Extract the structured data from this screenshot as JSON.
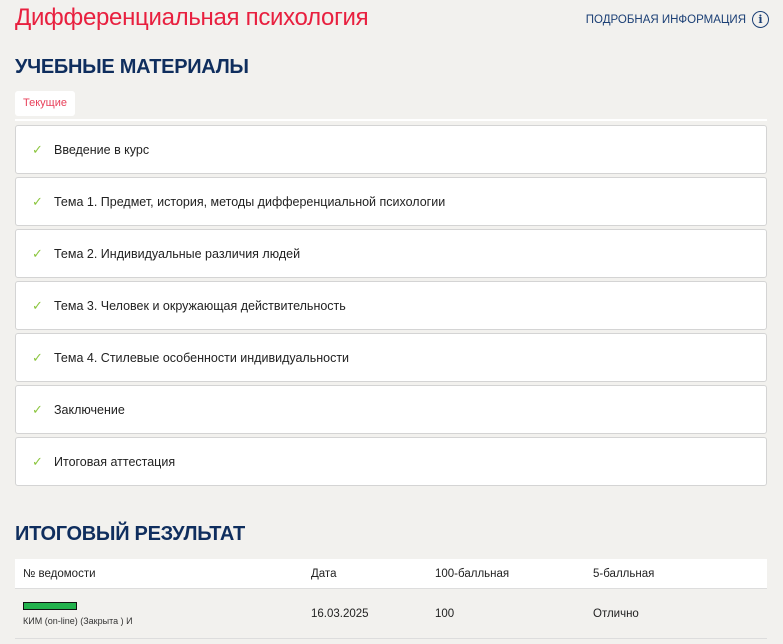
{
  "header": {
    "title": "Дифференциальная психология",
    "info_link": "ПОДРОБНАЯ ИНФОРМАЦИЯ",
    "info_icon": "i"
  },
  "materials": {
    "heading": "УЧЕБНЫЕ МАТЕРИАЛЫ",
    "tab": "Текущие",
    "check": "✓",
    "items": [
      "Введение в курс",
      "Тема 1. Предмет, история, методы дифференциальной психологии",
      "Тема 2. Индивидуальные различия людей",
      "Тема 3. Человек и окружающая действительность",
      "Тема 4. Стилевые особенности индивидуальности",
      "Заключение",
      "Итоговая аттестация"
    ]
  },
  "result": {
    "heading": "ИТОГОВЫЙ РЕЗУЛЬТАТ",
    "columns": [
      "№ ведомости",
      "Дата",
      "100-балльная",
      "5-балльная"
    ],
    "rows": [
      {
        "name": "КИМ (on-line) (Закрыта ) И",
        "date": "16.03.2025",
        "score100": "100",
        "score5": "Отлично",
        "progress": 1.0,
        "bar_color": "#22b14c"
      }
    ]
  }
}
